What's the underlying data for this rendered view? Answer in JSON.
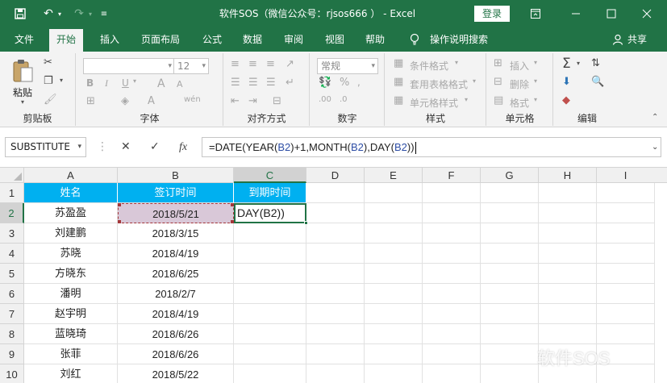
{
  "window": {
    "title": "软件SOS（微信公众号：rjsos666 ） - Excel",
    "login_label": "登录",
    "accent": "#217346"
  },
  "tabs": [
    {
      "label": "文件"
    },
    {
      "label": "开始"
    },
    {
      "label": "插入"
    },
    {
      "label": "页面布局"
    },
    {
      "label": "公式"
    },
    {
      "label": "数据"
    },
    {
      "label": "审阅"
    },
    {
      "label": "视图"
    },
    {
      "label": "帮助"
    }
  ],
  "tell_me": "操作说明搜索",
  "share": "共享",
  "ribbon": {
    "clipboard": {
      "label": "剪贴板",
      "paste": "粘贴"
    },
    "font": {
      "label": "字体",
      "size": "12",
      "bold": "B",
      "italic": "I",
      "underline": "U",
      "grow": "A",
      "shrink": "A"
    },
    "alignment": {
      "label": "对齐方式"
    },
    "number": {
      "label": "数字",
      "format": "常规"
    },
    "styles": {
      "label": "样式",
      "conditional": "条件格式",
      "table": "套用表格格式",
      "cell": "单元格样式"
    },
    "cells": {
      "label": "单元格",
      "insert": "插入",
      "delete": "删除",
      "format": "格式"
    },
    "editing": {
      "label": "编辑",
      "sum": "Σ"
    }
  },
  "formula_bar": {
    "name_box": "SUBSTITUTE",
    "fx": "fx",
    "formula_parts": [
      {
        "text": "=DATE(YEAR(",
        "ref": false
      },
      {
        "text": "B2",
        "ref": true
      },
      {
        "text": ")+1,MONTH(",
        "ref": false
      },
      {
        "text": "B2",
        "ref": true
      },
      {
        "text": "),DAY(",
        "ref": false
      },
      {
        "text": "B2",
        "ref": true
      },
      {
        "text": "))",
        "ref": false
      }
    ]
  },
  "sheet": {
    "columns": [
      "A",
      "B",
      "C",
      "D",
      "E",
      "F",
      "G",
      "H",
      "I"
    ],
    "rows": [
      "1",
      "2",
      "3",
      "4",
      "5",
      "6",
      "7",
      "8",
      "9",
      "10"
    ],
    "headers": [
      "姓名",
      "签订时间",
      "到期时间"
    ],
    "header_color": "#00b0f0",
    "data": [
      {
        "name": "苏盈盈",
        "date": "2018/5/21",
        "expiry": "DAY(B2))"
      },
      {
        "name": "刘建鹏",
        "date": "2018/3/15",
        "expiry": ""
      },
      {
        "name": "苏晓",
        "date": "2018/4/19",
        "expiry": ""
      },
      {
        "name": "方晓东",
        "date": "2018/6/25",
        "expiry": ""
      },
      {
        "name": "潘明",
        "date": "2018/2/7",
        "expiry": ""
      },
      {
        "name": "赵宇明",
        "date": "2018/4/19",
        "expiry": ""
      },
      {
        "name": "蓝晓琦",
        "date": "2018/6/26",
        "expiry": ""
      },
      {
        "name": "张菲",
        "date": "2018/6/26",
        "expiry": ""
      },
      {
        "name": "刘红",
        "date": "2018/5/22",
        "expiry": ""
      }
    ]
  },
  "watermark": "软件SOS"
}
